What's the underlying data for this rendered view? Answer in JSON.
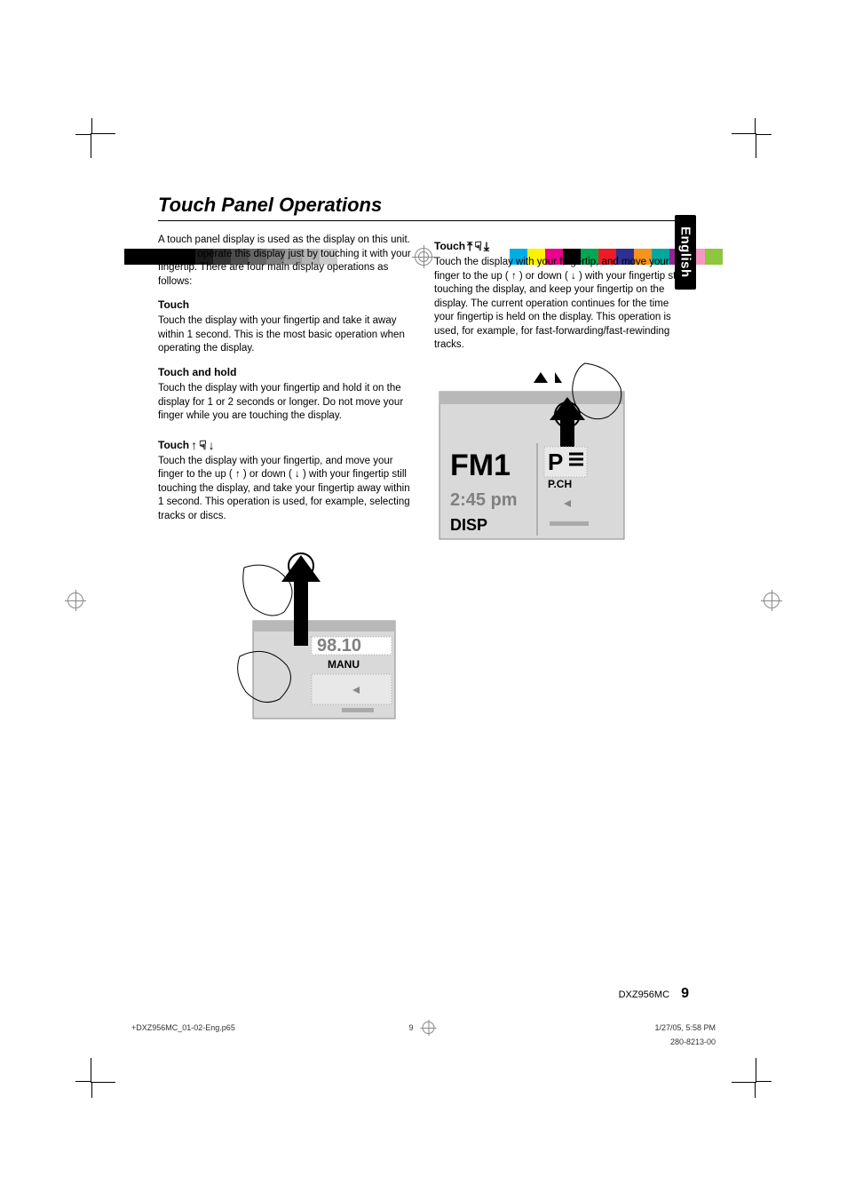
{
  "title": "Touch Panel Operations",
  "side_tab": "English",
  "intro": "A touch panel display is used as the display on this unit. You can operate this display just by touching it with your fingertip. There are four main display operations as follows:",
  "sections": {
    "touch": {
      "heading": "Touch",
      "body": "Touch the display with your fingertip and take it away within 1 second. This is the most basic operation when operating the display."
    },
    "touch_hold": {
      "heading": "Touch and hold",
      "body": "Touch the display with your fingertip and hold it on the display for 1 or 2 seconds or longer. Do not move your finger while you are touching the display."
    },
    "touch_swipe": {
      "heading": "Touch",
      "body": "Touch the display with your fingertip, and move your finger to the up ( ↑ ) or down ( ↓ ) with your fingertip still touching the display, and take your fingertip away within 1 second. This operation is used, for example, selecting tracks or discs."
    },
    "touch_swipe_hold": {
      "heading": "Touch",
      "body": "Touch the display with your fingertip, and move your finger to the up ( ↑ ) or down ( ↓ ) with your fingertip still touching the display, and keep your fingertip on the display. The current operation continues for the time your fingertip is held on the display. This operation is used, for example, for fast-forwarding/fast-rewinding tracks."
    }
  },
  "illus1": {
    "freq": "98.10",
    "label": "MANU"
  },
  "illus2": {
    "band": "FM1",
    "p": "P",
    "pch": "P.CH",
    "time": "2:45 pm",
    "disp": "DISP"
  },
  "footer": {
    "model": "DXZ956MC",
    "page": "9",
    "file": "+DXZ956MC_01-02-Eng.p65",
    "midpage": "9",
    "datetime": "1/27/05, 5:58 PM",
    "code": "280-8213-00"
  },
  "graybar_colors": [
    "#000000",
    "#000000",
    "#000000",
    "#000000",
    "#1a1a1a",
    "#333333",
    "#4d4d4d",
    "#666666",
    "#808080",
    "#999999",
    "#b3b3b3",
    "#cccccc"
  ],
  "colorbar_colors": [
    "#00aee6",
    "#fff200",
    "#ec008c",
    "#000000",
    "#00a651",
    "#ed1c24",
    "#2e3192",
    "#f7941d",
    "#00a99d",
    "#92278f",
    "#f49ac1",
    "#8dc63f"
  ]
}
